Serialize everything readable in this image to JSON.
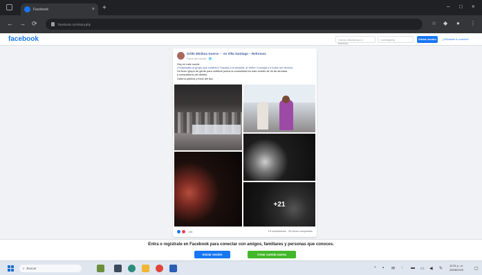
{
  "browser": {
    "tab_title": "Facebook",
    "tab_close": "×",
    "new_tab": "+",
    "url": "facebook.com/story.php",
    "nav_back": "←",
    "nav_forward": "→",
    "nav_reload": "⟳",
    "window_minimize": "–",
    "window_maximize": "□",
    "window_close": "×"
  },
  "facebook": {
    "logo": "facebook",
    "email_placeholder": "Correo electrónico o teléfono",
    "password_placeholder": "Contraseña",
    "login_label": "Iniciar sesión",
    "forgot_label": "¿Olvidaste tu cuenta?"
  },
  "post": {
    "author": "Grillo Minibus Guerra ··· en Villa Santiago – Reformas",
    "meta": "Fotos del evento · 🌐",
    "lines": [
      "Hoy en este noche.",
      "¡Felicidades al grupo que colaboró! Gracias a la alcaldía, al Señor Concejal y a todos los vecinos.",
      "Un buen grupo de gente para celebrar juntos la comunidad en este evento de fin de semana",
      "y compañeros del distrito.",
      "Galería pública y fotos del día."
    ],
    "more_photos": "+21",
    "reaction_count": "146",
    "stats": "19 comentarios · 25 veces compartido"
  },
  "login_banner": {
    "text": "Entra o regístrate en Facebook para conectar con amigos, familiares y personas que conoces.",
    "login_button": "Iniciar sesión",
    "create_button": "Crear cuenta nueva"
  },
  "taskbar": {
    "search_label": "Buscar",
    "clock_time": "12:01 p. m.",
    "clock_date": "25/08/2023"
  },
  "colors": {
    "facebook_blue": "#1877f2",
    "create_green": "#42b72a",
    "chrome_dark": "#202124"
  }
}
